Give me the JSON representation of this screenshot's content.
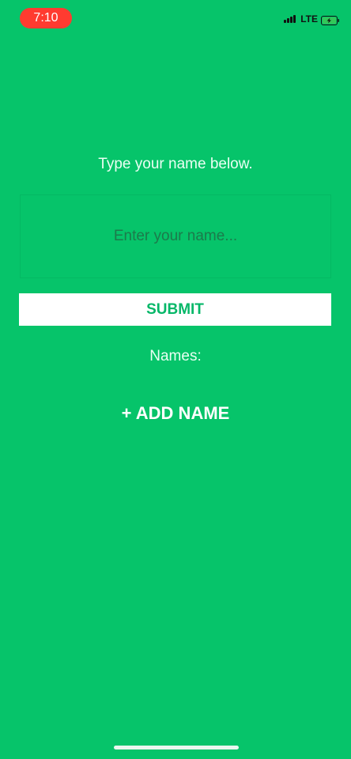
{
  "status_bar": {
    "time": "7:10",
    "network": "LTE",
    "icons": {
      "signal": "cellular-signal-icon",
      "battery": "battery-charging-icon"
    }
  },
  "main": {
    "prompt": "Type your name below.",
    "name_input": {
      "value": "",
      "placeholder": "Enter your name..."
    },
    "submit_label": "SUBMIT",
    "names_label": "Names:",
    "add_name_label": "+ ADD NAME"
  },
  "colors": {
    "background": "#06c46a",
    "accent_text": "#06b768",
    "time_pill": "#ff3b30"
  }
}
